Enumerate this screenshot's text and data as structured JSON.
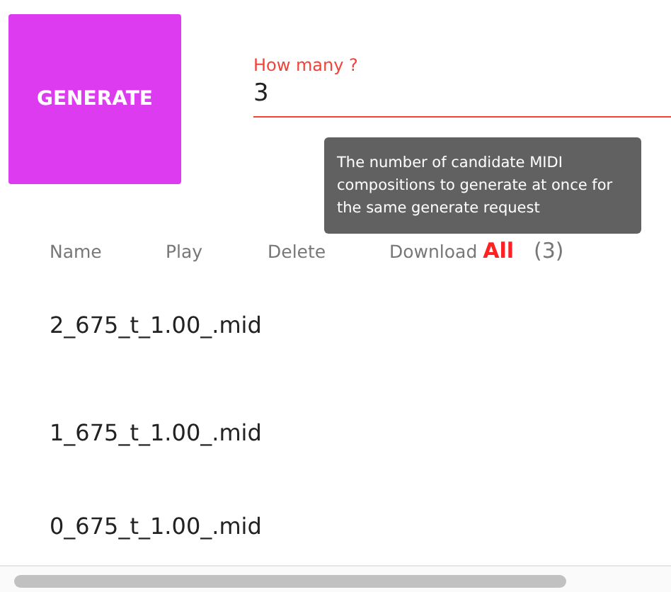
{
  "generate_button": {
    "label": "GENERATE"
  },
  "count_field": {
    "label": "How many ?",
    "value": "3"
  },
  "tooltip": {
    "text": "The number of candidate MIDI compositions to generate at once for the same generate request"
  },
  "table": {
    "columns": [
      "Name",
      "Play",
      "Delete",
      "Download **All**"
    ],
    "count": "(3)",
    "rows": [
      {
        "name": "2_675_t_1.00_.mid"
      },
      {
        "name": "1_675_t_1.00_.mid"
      },
      {
        "name": "0_675_t_1.00_.mid"
      }
    ]
  }
}
